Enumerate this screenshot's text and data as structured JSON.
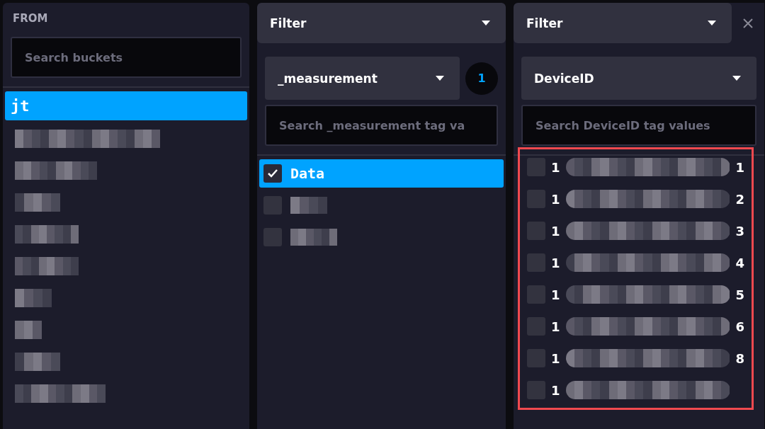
{
  "from": {
    "title": "FROM",
    "search": {
      "placeholder": "Search buckets"
    },
    "buckets": [
      {
        "kind": "text",
        "label": "jt",
        "selected": true
      },
      {
        "kind": "redacted",
        "selected": false
      },
      {
        "kind": "redacted",
        "selected": false
      },
      {
        "kind": "redacted",
        "selected": false
      },
      {
        "kind": "redacted",
        "selected": false
      },
      {
        "kind": "redacted",
        "selected": false
      },
      {
        "kind": "redacted",
        "selected": false
      },
      {
        "kind": "redacted",
        "selected": false
      },
      {
        "kind": "redacted",
        "selected": false
      },
      {
        "kind": "redacted",
        "selected": false
      }
    ]
  },
  "filters": [
    {
      "mode": "Filter",
      "key": "_measurement",
      "count": "1",
      "closable": false,
      "search": {
        "placeholder": "Search _measurement tag va"
      },
      "highlighted": false,
      "values": [
        {
          "kind": "text",
          "label": "Data",
          "checked": true
        },
        {
          "kind": "redacted",
          "checked": false
        },
        {
          "kind": "redacted",
          "checked": false
        }
      ]
    },
    {
      "mode": "Filter",
      "key": "DeviceID",
      "closable": true,
      "search": {
        "placeholder": "Search DeviceID tag values"
      },
      "highlighted": true,
      "values": [
        {
          "kind": "partial",
          "prefix": "1",
          "suffix": "1",
          "checked": false
        },
        {
          "kind": "partial",
          "prefix": "1",
          "suffix": "2",
          "checked": false
        },
        {
          "kind": "partial",
          "prefix": "1",
          "suffix": "3",
          "checked": false
        },
        {
          "kind": "partial",
          "prefix": "1",
          "suffix": "4",
          "checked": false
        },
        {
          "kind": "partial",
          "prefix": "1",
          "suffix": "5",
          "checked": false
        },
        {
          "kind": "partial",
          "prefix": "1",
          "suffix": "6",
          "checked": false
        },
        {
          "kind": "partial",
          "prefix": "1",
          "suffix": "8",
          "checked": false
        },
        {
          "kind": "partial",
          "prefix": "1",
          "checked": false
        }
      ]
    }
  ]
}
